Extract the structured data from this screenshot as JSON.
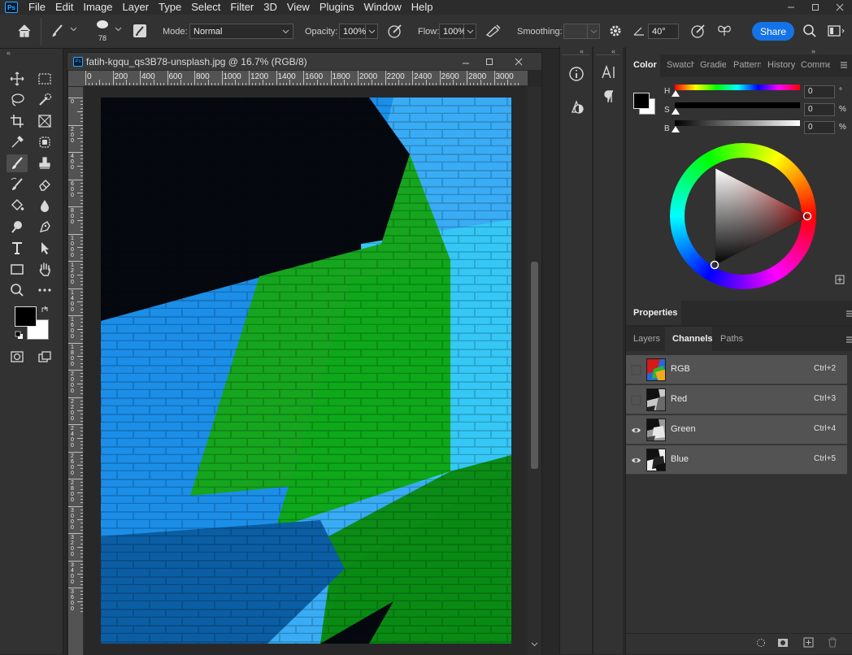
{
  "menubar": {
    "items": [
      "File",
      "Edit",
      "Image",
      "Layer",
      "Type",
      "Select",
      "Filter",
      "3D",
      "View",
      "Plugins",
      "Window",
      "Help"
    ],
    "logo": "Ps"
  },
  "options": {
    "brush_size": "78",
    "mode_label": "Mode:",
    "mode_value": "Normal",
    "opacity_label": "Opacity:",
    "opacity_value": "100%",
    "flow_label": "Flow:",
    "flow_value": "100%",
    "smoothing_label": "Smoothing:",
    "smoothing_value": "",
    "angle_value": "40°",
    "share_label": "Share"
  },
  "document": {
    "title": "fatih-kgqu_qs3B78-unsplash.jpg @ 16.7% (RGB/8)",
    "ruler_h": [
      "0",
      "200",
      "400",
      "600",
      "800",
      "1000",
      "1200",
      "1400",
      "1600",
      "1800",
      "2000",
      "2200",
      "2400",
      "2600",
      "2800",
      "3000"
    ],
    "ruler_v": [
      "0",
      "2\n0\n0",
      "4\n0\n0",
      "6\n0\n0",
      "8\n0\n0",
      "1\n0\n0\n0",
      "1\n2\n0\n0",
      "1\n4\n0\n0",
      "1\n6\n0\n0",
      "1\n8\n0\n0",
      "2\n0\n0\n0",
      "2\n2\n0\n0",
      "2\n4\n0\n0",
      "2\n6\n0\n0",
      "2\n8\n0\n0",
      "3\n0\n0\n0",
      "3\n2\n0\n0",
      "3\n4\n0\n0",
      "3\n6\n0\n0"
    ]
  },
  "color_panel": {
    "tabs": [
      "Color",
      "Swatch",
      "Gradie",
      "Pattern",
      "History",
      "Comme"
    ],
    "active_tab": "Color",
    "h_label": "H",
    "h_value": "0",
    "h_unit": "°",
    "s_label": "S",
    "s_value": "0",
    "s_unit": "%",
    "b_label": "B",
    "b_value": "0",
    "b_unit": "%"
  },
  "properties_panel": {
    "title": "Properties"
  },
  "layers_panel": {
    "tabs": [
      "Layers",
      "Channels",
      "Paths"
    ],
    "active_tab": "Channels",
    "channels": [
      {
        "name": "RGB",
        "shortcut": "Ctrl+2",
        "visible": false
      },
      {
        "name": "Red",
        "shortcut": "Ctrl+3",
        "visible": false
      },
      {
        "name": "Green",
        "shortcut": "Ctrl+4",
        "visible": true
      },
      {
        "name": "Blue",
        "shortcut": "Ctrl+5",
        "visible": true
      }
    ]
  },
  "colors": {
    "accent": "#1473e6",
    "foreground": "#000000",
    "background": "#ffffff"
  }
}
